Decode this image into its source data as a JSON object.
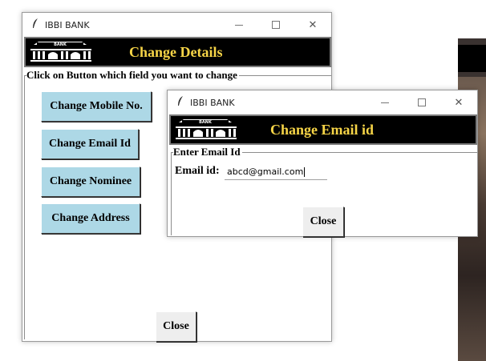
{
  "main_window": {
    "title": "IBBI BANK",
    "header_title": "Change Details",
    "group_label": "Click on Button which field you want to change",
    "buttons": {
      "mobile": "Change Mobile No.",
      "email": "Change Email Id",
      "nominee": "Change Nominee",
      "address": "Change Address",
      "close": "Close"
    }
  },
  "dialog_window": {
    "title": "IBBI BANK",
    "header_title": "Change Email id",
    "group_label": "Enter Email Id",
    "email_label": "Email id:",
    "email_value": "abcd@gmail.com",
    "close": "Close"
  },
  "logo_text": "BANK",
  "icons": {
    "app": "feather-icon",
    "minimize": "minimize-icon",
    "maximize": "maximize-icon",
    "close": "close-icon"
  },
  "colors": {
    "banner_bg": "#000000",
    "banner_text": "#f6d447",
    "button_blue": "#add8e6"
  }
}
